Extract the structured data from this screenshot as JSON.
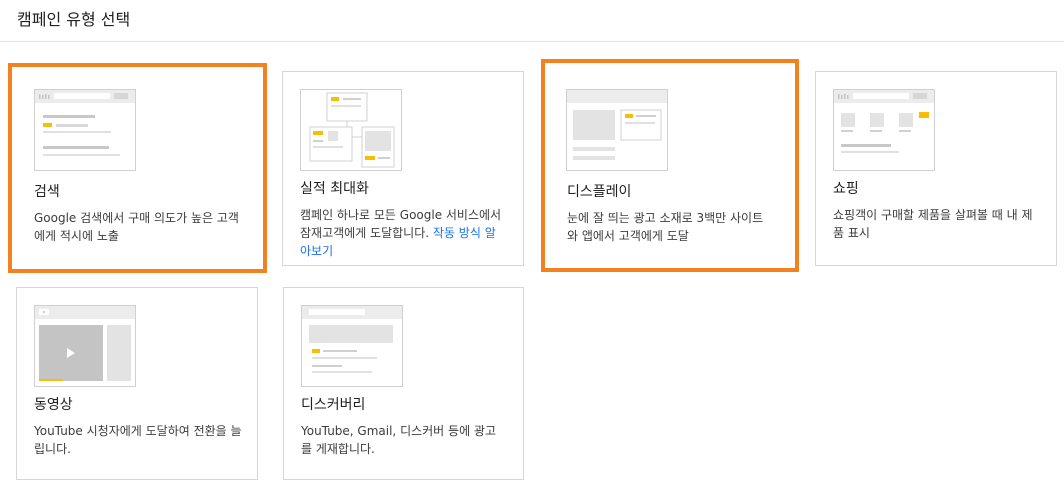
{
  "header": {
    "title": "캠페인 유형 선택"
  },
  "theme": {
    "selected_border": "#f48120",
    "accent_yellow": "#fbbc04",
    "link": "#1a73e8"
  },
  "cards": [
    {
      "id": "search",
      "title": "검색",
      "desc": "Google 검색에서 구매 의도가 높은 고객에게 적시에 노출",
      "selected": true,
      "icon": "search-illustration-icon"
    },
    {
      "id": "performance",
      "title": "실적 최대화",
      "desc": "캠페인 하나로 모든 Google 서비스에서 잠재고객에게 도달합니다.",
      "link": "작동 방식 알아보기",
      "selected": false,
      "icon": "performance-max-illustration-icon"
    },
    {
      "id": "display",
      "title": "디스플레이",
      "desc": "눈에 잘 띄는 광고 소재로 3백만 사이트와 앱에서 고객에게 도달",
      "selected": true,
      "icon": "display-illustration-icon"
    },
    {
      "id": "shopping",
      "title": "쇼핑",
      "desc": "쇼핑객이 구매할 제품을 살펴볼 때 내 제품 표시",
      "selected": false,
      "icon": "shopping-illustration-icon"
    },
    {
      "id": "video",
      "title": "동영상",
      "desc": "YouTube 시청자에게 도달하여 전환을 늘립니다.",
      "selected": false,
      "icon": "video-illustration-icon"
    },
    {
      "id": "discovery",
      "title": "디스커버리",
      "desc": "YouTube, Gmail, 디스커버 등에 광고를 게재합니다.",
      "selected": false,
      "icon": "discovery-illustration-icon"
    }
  ]
}
